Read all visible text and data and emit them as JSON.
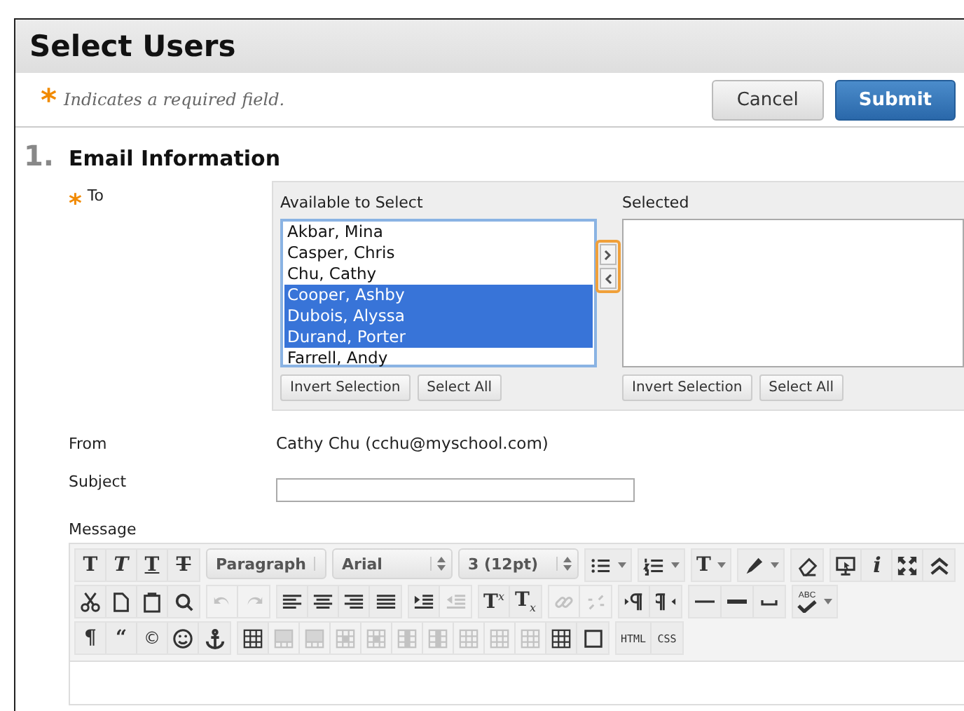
{
  "page_title": "Select Users",
  "required": {
    "mark": "*",
    "note": "Indicates a required field."
  },
  "buttons": [
    {
      "label": "Cancel",
      "kind": "secondary"
    },
    {
      "label": "Submit",
      "kind": "primary"
    }
  ],
  "section": {
    "number": "1.",
    "title": "Email Information"
  },
  "to": {
    "label": "To",
    "required": true,
    "available": {
      "label": "Available to Select",
      "items": [
        {
          "name": "Akbar, Mina",
          "selected": false
        },
        {
          "name": "Casper, Chris",
          "selected": false
        },
        {
          "name": "Chu, Cathy",
          "selected": false
        },
        {
          "name": "Cooper, Ashby",
          "selected": true
        },
        {
          "name": "Dubois, Alyssa",
          "selected": true
        },
        {
          "name": "Durand, Porter",
          "selected": true
        },
        {
          "name": "Farrell, Andy",
          "selected": false
        }
      ],
      "buttons": [
        "Invert Selection",
        "Select All"
      ]
    },
    "selected": {
      "label": "Selected",
      "buttons": [
        "Invert Selection",
        "Select All"
      ]
    }
  },
  "from": {
    "label": "From",
    "value": "Cathy Chu (cchu@myschool.com)"
  },
  "subject": {
    "label": "Subject"
  },
  "message": {
    "label": "Message",
    "toolbar": [
      [
        [
          {
            "kind": "text",
            "label": "T",
            "disabled": false
          },
          {
            "kind": "text",
            "label": "T",
            "disabled": false
          },
          {
            "kind": "text",
            "label": "T",
            "disabled": false
          },
          {
            "kind": "text",
            "label": "T",
            "disabled": false
          }
        ],
        [
          {
            "kind": "select",
            "label": "Paragraph",
            "disabled": false
          }
        ],
        [
          {
            "kind": "select",
            "label": "Arial",
            "disabled": false
          }
        ],
        [
          {
            "kind": "select",
            "label": "3 (12pt)",
            "disabled": false
          }
        ],
        [
          {
            "kind": "split",
            "disabled": false
          }
        ],
        [
          {
            "kind": "split",
            "disabled": false
          }
        ],
        [
          {
            "kind": "split-text",
            "label": "T",
            "disabled": false
          }
        ],
        [
          {
            "kind": "split",
            "disabled": false
          }
        ],
        [
          {
            "kind": "icon",
            "disabled": false
          }
        ],
        [
          {
            "kind": "icon",
            "disabled": false
          },
          {
            "kind": "text",
            "label": "i",
            "disabled": false
          },
          {
            "kind": "icon",
            "disabled": false
          },
          {
            "kind": "icon",
            "disabled": false
          }
        ]
      ],
      [
        [
          {
            "kind": "icon",
            "disabled": false
          },
          {
            "kind": "icon",
            "disabled": false
          },
          {
            "kind": "icon",
            "disabled": false
          },
          {
            "kind": "icon",
            "disabled": false
          }
        ],
        [
          {
            "kind": "icon",
            "disabled": true
          },
          {
            "kind": "icon",
            "disabled": true
          }
        ],
        [
          {
            "kind": "icon",
            "disabled": false
          },
          {
            "kind": "icon",
            "disabled": false
          },
          {
            "kind": "icon",
            "disabled": false
          },
          {
            "kind": "icon",
            "disabled": false
          }
        ],
        [
          {
            "kind": "icon",
            "disabled": false
          },
          {
            "kind": "icon",
            "disabled": true
          }
        ],
        [
          {
            "kind": "text",
            "label": "T$^{x}$",
            "disabled": false
          },
          {
            "kind": "text",
            "label": "T$_{x}$",
            "disabled": false
          }
        ],
        [
          {
            "kind": "icon",
            "disabled": true
          },
          {
            "kind": "icon",
            "disabled": true
          }
        ],
        [
          {
            "kind": "icon",
            "disabled": false
          },
          {
            "kind": "icon",
            "disabled": false
          }
        ],
        [
          {
            "kind": "icon",
            "disabled": false
          },
          {
            "kind": "icon",
            "disabled": false
          },
          {
            "kind": "icon",
            "disabled": false
          }
        ],
        [
          {
            "kind": "spell",
            "label": "ABC",
            "disabled": false
          }
        ]
      ],
      [
        [
          {
            "kind": "text",
            "label": "¶",
            "disabled": false
          },
          {
            "kind": "text",
            "label": "“",
            "disabled": false
          },
          {
            "kind": "text",
            "label": "©",
            "disabled": false
          },
          {
            "kind": "icon",
            "disabled": false
          },
          {
            "kind": "icon",
            "disabled": false
          }
        ],
        [
          {
            "kind": "icon",
            "disabled": false
          },
          {
            "kind": "icon",
            "disabled": true
          },
          {
            "kind": "icon",
            "disabled": true
          },
          {
            "kind": "icon",
            "disabled": true
          },
          {
            "kind": "icon",
            "disabled": true
          },
          {
            "kind": "icon",
            "disabled": true
          },
          {
            "kind": "icon",
            "disabled": true
          },
          {
            "kind": "icon",
            "disabled": true
          },
          {
            "kind": "icon",
            "disabled": true
          },
          {
            "kind": "icon",
            "disabled": true
          },
          {
            "kind": "icon",
            "disabled": false
          },
          {
            "kind": "icon",
            "disabled": false
          }
        ],
        [
          {
            "kind": "text",
            "label": "HTML",
            "disabled": false
          },
          {
            "kind": "text",
            "label": "CSS",
            "disabled": false
          }
        ]
      ]
    ]
  }
}
